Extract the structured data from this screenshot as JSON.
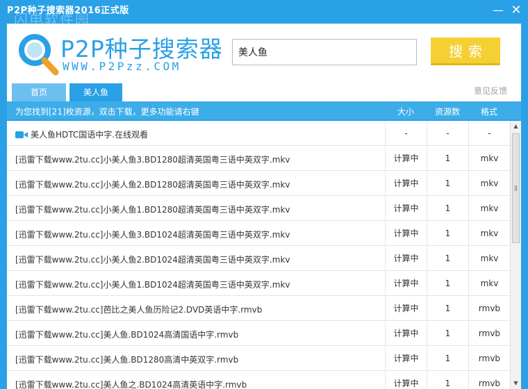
{
  "window": {
    "title": "P2P种子搜索器2016正式版",
    "watermark": "闪电软件园",
    "minimize": "—",
    "close": "✕"
  },
  "logo": {
    "name": "P2P种子搜索器",
    "url": "WWW.P2Pzz.COM"
  },
  "search": {
    "value": "美人鱼",
    "button": "搜索"
  },
  "tabs": [
    {
      "label": "首页"
    },
    {
      "label": "美人鱼"
    }
  ],
  "feedback": "意见反馈",
  "results_header": {
    "message": "为您找到[21]枚资源，双击下载，更多功能请右键",
    "col_size": "大小",
    "col_count": "资源数",
    "col_format": "格式"
  },
  "rows": [
    {
      "name": "美人鱼HDTC国语中字.在线观看",
      "size": "-",
      "count": "-",
      "format": "-",
      "video": true
    },
    {
      "name": "[迅雷下载www.2tu.cc]小美人鱼3.BD1280超清英国粤三语中英双字.mkv",
      "size": "计算中",
      "count": "1",
      "format": "mkv"
    },
    {
      "name": "[迅雷下载www.2tu.cc]小美人鱼2.BD1280超清英国粤三语中英双字.mkv",
      "size": "计算中",
      "count": "1",
      "format": "mkv"
    },
    {
      "name": "[迅雷下载www.2tu.cc]小美人鱼1.BD1280超清英国粤三语中英双字.mkv",
      "size": "计算中",
      "count": "1",
      "format": "mkv"
    },
    {
      "name": "[迅雷下载www.2tu.cc]小美人鱼3.BD1024超清英国粤三语中英双字.mkv",
      "size": "计算中",
      "count": "1",
      "format": "mkv"
    },
    {
      "name": "[迅雷下载www.2tu.cc]小美人鱼2.BD1024超清英国粤三语中英双字.mkv",
      "size": "计算中",
      "count": "1",
      "format": "mkv"
    },
    {
      "name": "[迅雷下载www.2tu.cc]小美人鱼1.BD1024超清英国粤三语中英双字.mkv",
      "size": "计算中",
      "count": "1",
      "format": "mkv"
    },
    {
      "name": "[迅雷下载www.2tu.cc]芭比之美人鱼历险记2.DVD英语中字.rmvb",
      "size": "计算中",
      "count": "1",
      "format": "rmvb"
    },
    {
      "name": "[迅雷下载www.2tu.cc]美人鱼.BD1024高清国语中字.rmvb",
      "size": "计算中",
      "count": "1",
      "format": "rmvb"
    },
    {
      "name": "[迅雷下载www.2tu.cc]美人鱼.BD1280高清中英双字.rmvb",
      "size": "计算中",
      "count": "1",
      "format": "rmvb"
    },
    {
      "name": "[迅雷下载www.2tu.cc]美人鱼之.BD1024高清英语中字.rmvb",
      "size": "计算中",
      "count": "1",
      "format": "rmvb"
    }
  ],
  "colors": {
    "accent": "#2aa0e6",
    "search_button": "#f5d033"
  }
}
